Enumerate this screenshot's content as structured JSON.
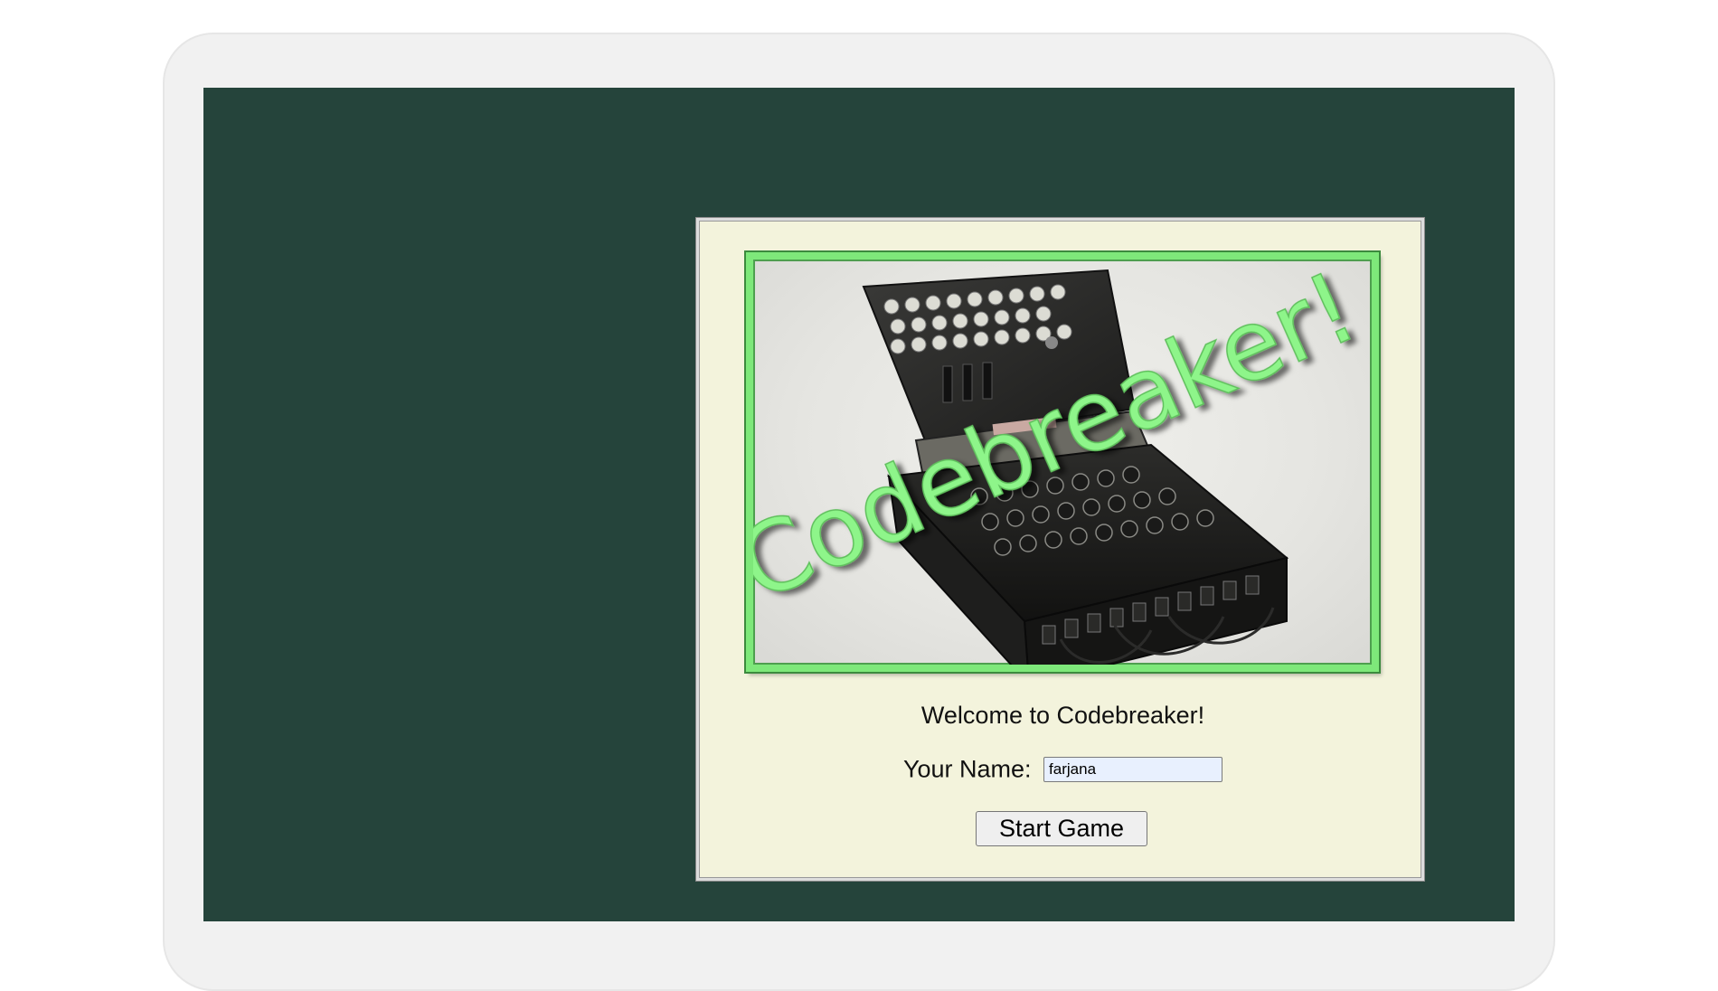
{
  "banner": {
    "title": "Codebreaker!",
    "image_subject": "enigma-machine",
    "frame_color": "#7ee87a"
  },
  "welcome_text": "Welcome to Codebreaker!",
  "name_field": {
    "label": "Your Name:",
    "value": "farjana"
  },
  "start_button": {
    "label": "Start Game"
  },
  "colors": {
    "screen_background": "#25443b",
    "panel_background": "#f3f3dc",
    "title_green": "#8ef58a"
  }
}
